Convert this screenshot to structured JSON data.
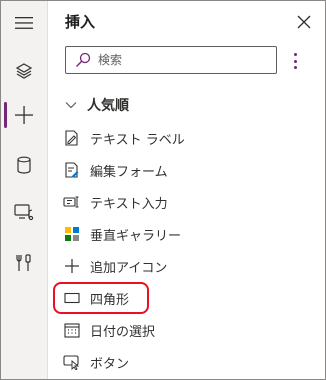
{
  "panel": {
    "title": "挿入"
  },
  "search": {
    "placeholder": "検索"
  },
  "section": {
    "label": "人気順"
  },
  "items": [
    {
      "label": "テキスト ラベル",
      "icon": "text-label-icon"
    },
    {
      "label": "編集フォーム",
      "icon": "edit-form-icon"
    },
    {
      "label": "テキスト入力",
      "icon": "text-input-icon"
    },
    {
      "label": "垂直ギャラリー",
      "icon": "vertical-gallery-icon"
    },
    {
      "label": "追加アイコン",
      "icon": "add-icon"
    },
    {
      "label": "四角形",
      "icon": "rectangle-icon"
    },
    {
      "label": "日付の選択",
      "icon": "date-picker-icon"
    },
    {
      "label": "ボタン",
      "icon": "button-icon"
    }
  ],
  "rail": [
    "menu-icon",
    "layers-icon",
    "insert-icon",
    "data-icon",
    "media-icon",
    "tools-icon"
  ],
  "colors": {
    "accent": "#742774",
    "highlight": "#e81123",
    "rail_bg": "#f3f2f1"
  }
}
